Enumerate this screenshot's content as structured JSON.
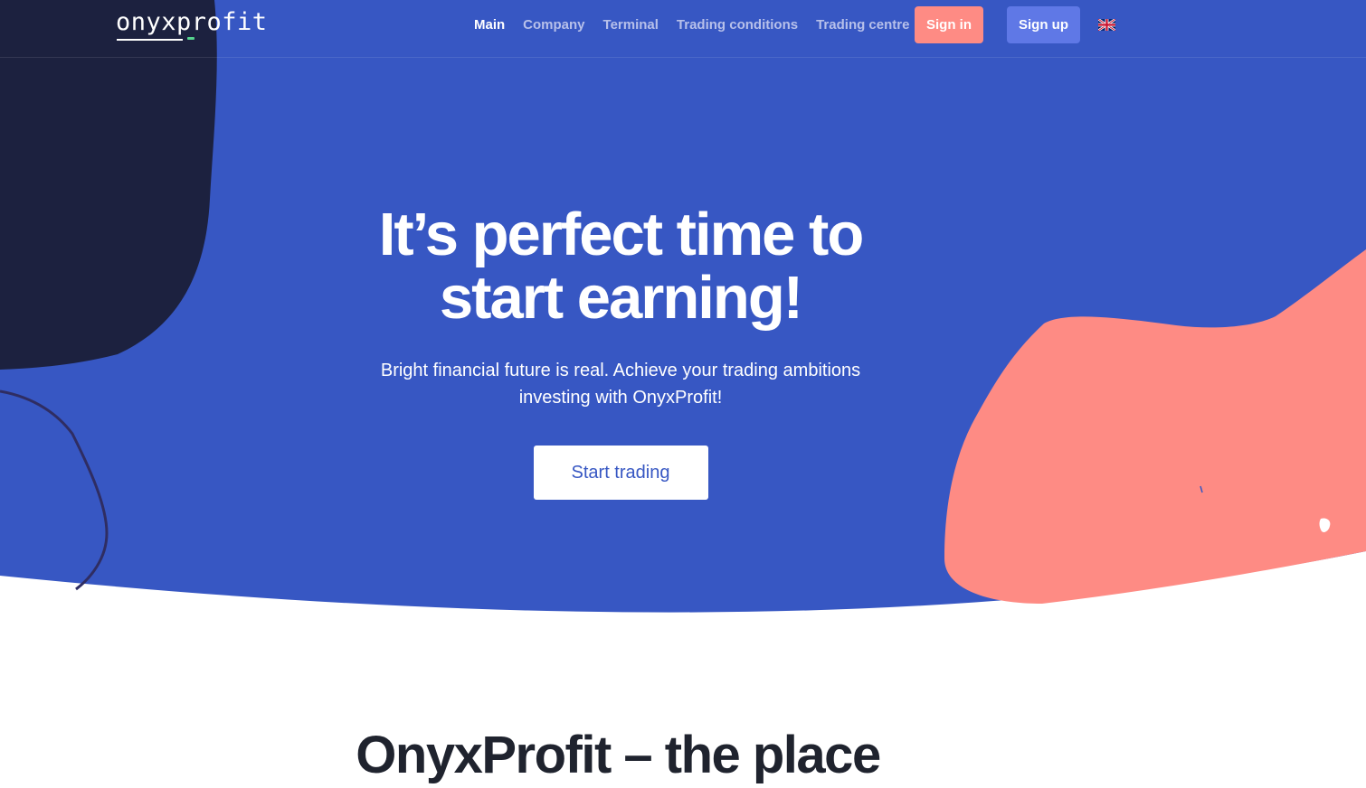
{
  "brand": {
    "logo_text": "onyxprofit"
  },
  "nav": {
    "items": [
      {
        "label": "Main",
        "active": true
      },
      {
        "label": "Company",
        "active": false
      },
      {
        "label": "Terminal",
        "active": false
      },
      {
        "label": "Trading conditions",
        "active": false
      },
      {
        "label": "Trading centre",
        "active": false
      }
    ],
    "sign_in": "Sign in",
    "sign_up": "Sign up",
    "language_icon": "uk-flag-icon"
  },
  "hero": {
    "title_line1": "It’s perfect time to",
    "title_line2": "start earning!",
    "subtitle_line1": "Bright financial future is real. Achieve your trading ambitions",
    "subtitle_line2": "investing with OnyxProfit!",
    "cta": "Start trading"
  },
  "section": {
    "title": "OnyxProfit – the place"
  },
  "colors": {
    "hero_bg": "#3757c3",
    "dark_blob": "#1c213f",
    "coral_blob": "#fe8b84",
    "sign_in_bg": "#fe8b84",
    "sign_up_bg": "#5f78e6",
    "nav_inactive": "#b7c0ea",
    "cta_text": "#3757c3",
    "heading_dark": "#1f232e"
  }
}
